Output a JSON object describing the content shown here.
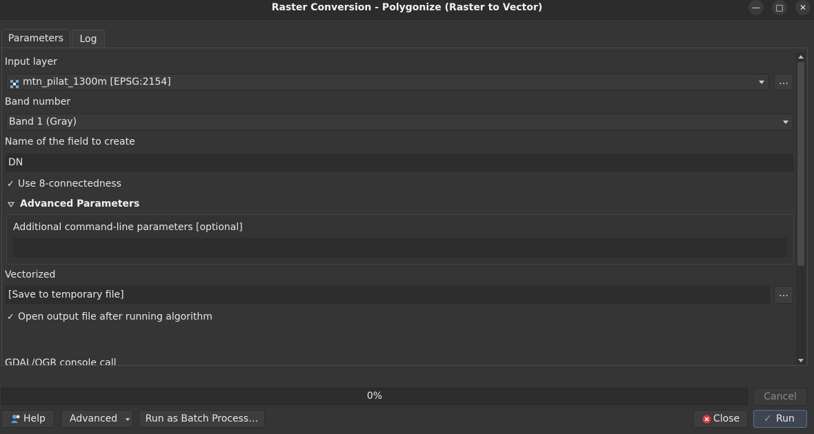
{
  "window": {
    "title": "Raster Conversion - Polygonize (Raster to Vector)",
    "minimize_glyph": "—",
    "maximize_glyph": "□",
    "close_glyph": "✕"
  },
  "tabs": [
    {
      "label": "Parameters",
      "active": true
    },
    {
      "label": "Log",
      "active": false
    }
  ],
  "params": {
    "input_layer_label": "Input layer",
    "input_layer_value": "mtn_pilat_1300m [EPSG:2154]",
    "browse_label": "…",
    "band_label": "Band number",
    "band_value": "Band 1 (Gray)",
    "field_label": "Name of the field to create",
    "field_value": "DN",
    "connectedness_label": "Use 8-connectedness",
    "connectedness_checked": true,
    "advanced_header": "Advanced Parameters",
    "extra_label": "Additional command-line parameters [optional]",
    "extra_value": "",
    "vectorized_label": "Vectorized",
    "vectorized_value": "[Save to temporary file]",
    "open_output_label": "Open output file after running algorithm",
    "open_output_checked": true,
    "console_label": "GDAL/OGR console call"
  },
  "progress": {
    "value_text": "0%"
  },
  "buttons": {
    "cancel": "Cancel",
    "help": "Help",
    "advanced": "Advanced",
    "batch": "Run as Batch Process…",
    "close": "Close",
    "run": "Run"
  },
  "colors": {
    "background": "#353535",
    "close_icon": "#e0383e",
    "run_accent": "#5a6e8c"
  },
  "icons": {
    "raster": "raster-layer-icon",
    "help": "help-icon",
    "close": "close-circle-icon",
    "run": "run-check-icon"
  }
}
